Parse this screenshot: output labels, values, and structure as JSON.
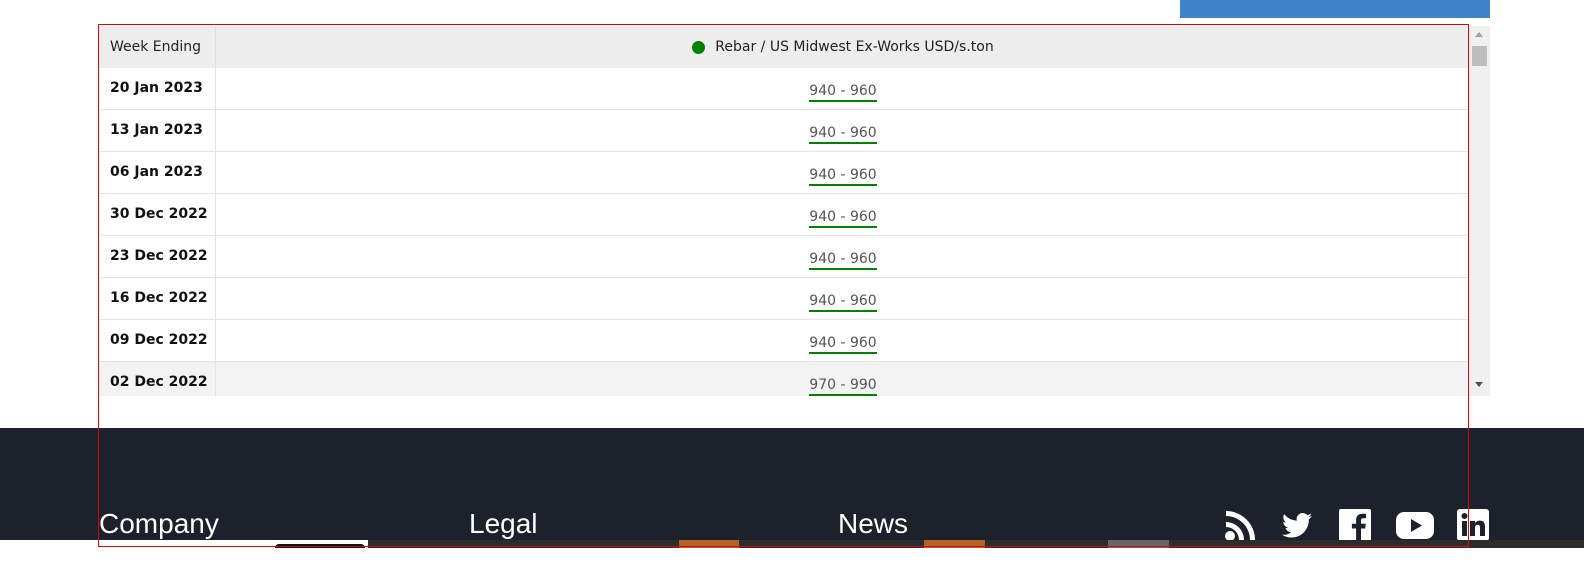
{
  "table": {
    "header": {
      "date_column": "Week Ending",
      "series_label": "Rebar / US Midwest Ex-Works USD/s.ton",
      "series_color": "#008000"
    },
    "rows": [
      {
        "date": "20 Jan 2023",
        "value": "940 - 960"
      },
      {
        "date": "13 Jan 2023",
        "value": "940 - 960"
      },
      {
        "date": "06 Jan 2023",
        "value": "940 - 960"
      },
      {
        "date": "30 Dec 2022",
        "value": "940 - 960"
      },
      {
        "date": "23 Dec 2022",
        "value": "940 - 960"
      },
      {
        "date": "16 Dec 2022",
        "value": "940 - 960"
      },
      {
        "date": "09 Dec 2022",
        "value": "940 - 960"
      },
      {
        "date": "02 Dec 2022",
        "value": "970 - 990"
      }
    ]
  },
  "footer": {
    "headings": {
      "company": "Company",
      "legal": "Legal",
      "news": "News"
    },
    "social_icons": [
      "rss-icon",
      "twitter-icon",
      "facebook-icon",
      "youtube-icon",
      "linkedin-icon"
    ]
  },
  "colors": {
    "accent_blue": "#3d84c9",
    "footer_bg": "#1d212b",
    "link_underline": "#008000",
    "highlight_outline": "#e00000"
  }
}
